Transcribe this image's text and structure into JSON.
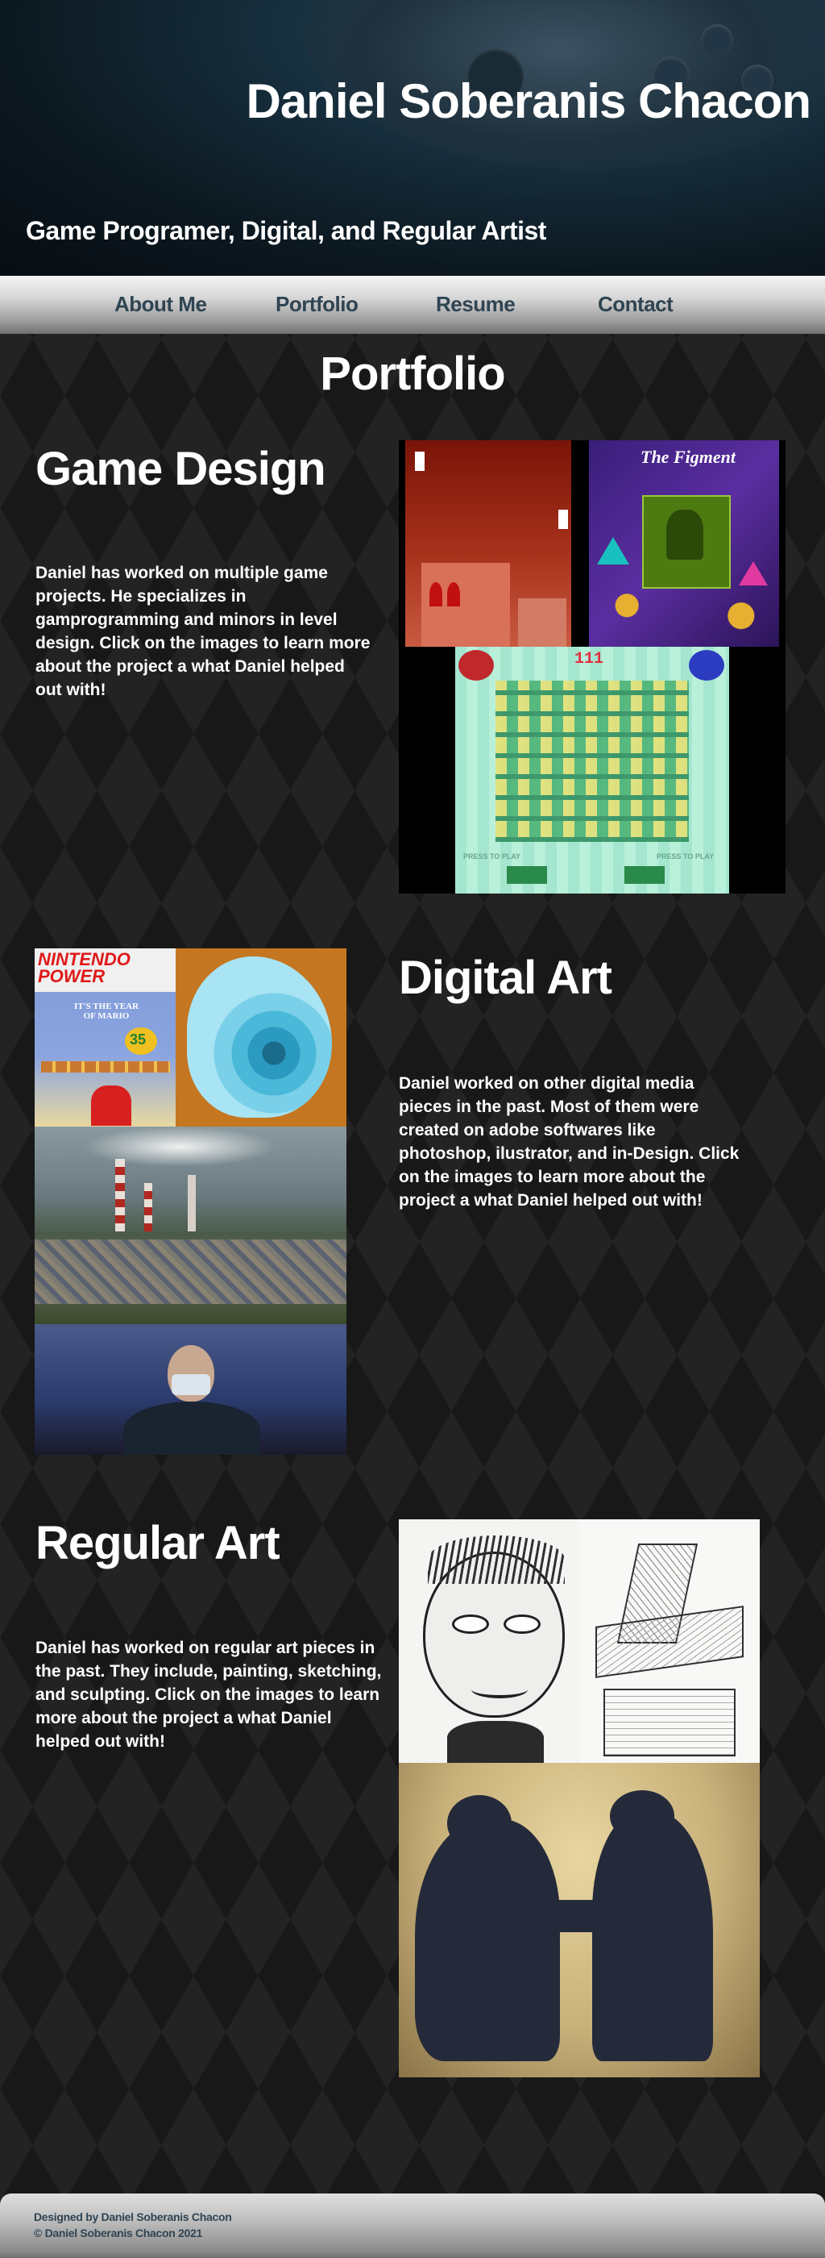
{
  "header": {
    "title": "Daniel Soberanis Chacon",
    "tagline": "Game Programer, Digital, and Regular Artist"
  },
  "nav": {
    "items": [
      {
        "label": "About Me"
      },
      {
        "label": "Portfolio"
      },
      {
        "label": "Resume"
      },
      {
        "label": "Contact"
      }
    ]
  },
  "page": {
    "heading": "Portfolio"
  },
  "sections": {
    "game_design": {
      "title": "Game Design",
      "text": "Daniel has worked on multiple game projects. He specializes in gamprogramming and minors in level design. Click on the images to learn more about the project a what Daniel helped out with!",
      "thumbs": {
        "figment_title": "The Figment",
        "arcade_score": "111",
        "press_to_play": "PRESS TO PLAY"
      }
    },
    "digital_art": {
      "title": "Digital Art",
      "text": "Daniel worked on other digital media pieces in the past. Most of them were created on adobe softwares like photoshop, ilustrator, and in-Design. Click on the images to learn more about the project a what Daniel helped out with!",
      "thumbs": {
        "magazine_title": "NINTENDO POWER",
        "magazine_headline": "IT'S THE YEAR OF MARIO",
        "magazine_badge": "35"
      }
    },
    "regular_art": {
      "title": "Regular Art",
      "text": "Daniel has worked on regular art pieces in the past.  They include, painting, sketching, and sculpting.  Click on the images to learn more about the project a what Daniel helped out with!"
    }
  },
  "footer": {
    "designed_by": "Designed by Daniel Soberanis Chacon",
    "copyright": "© Daniel Soberanis Chacon 2021"
  },
  "colors": {
    "background": "#1c1c1c",
    "nav_text": "#2f4452",
    "header_dark": "#0c1820"
  },
  "icons": {
    "header_art": "game-controller-icon"
  }
}
